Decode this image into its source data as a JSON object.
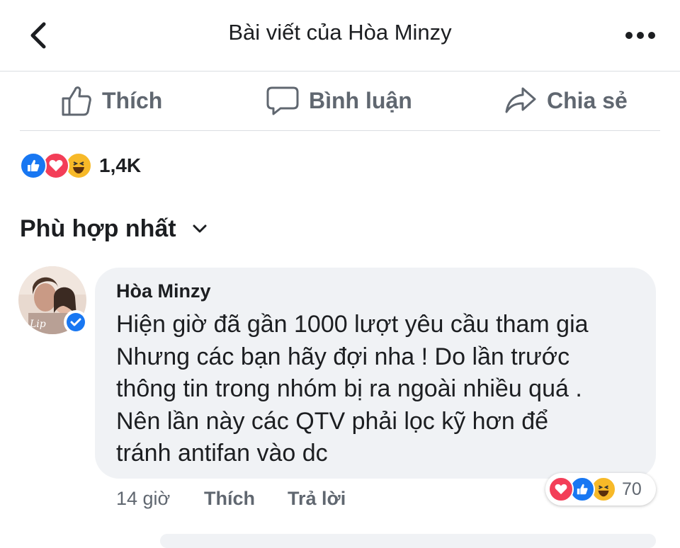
{
  "header": {
    "title": "Bài viết của Hòa Minzy"
  },
  "actions": {
    "like": "Thích",
    "comment": "Bình luận",
    "share": "Chia sẻ"
  },
  "reactions": {
    "count": "1,4K",
    "types": [
      "like-icon",
      "love-icon",
      "haha-icon"
    ]
  },
  "sort": {
    "label": "Phù hợp nhất"
  },
  "comment": {
    "author": "Hòa Minzy",
    "lines": [
      "Hiện giờ đã gần 1000 lượt yêu cầu tham gia",
      "Nhưng các bạn hãy đợi nha ! Do lần trước",
      "thông tin trong nhóm bị ra ngoài nhiều quá .",
      "Nên lần này các QTV phải lọc kỹ hơn để",
      "tránh antifan vào dc"
    ],
    "time": "14 giờ",
    "like": "Thích",
    "reply": "Trả lời",
    "reaction_count": "70",
    "reaction_types": [
      "love-icon",
      "like-icon",
      "haha-icon"
    ]
  },
  "colors": {
    "like_blue": "#1877f2",
    "love_red": "#f33e58",
    "haha_yellow": "#f7b928",
    "secondary_text": "#606770",
    "bubble_bg": "#f0f2f5"
  }
}
